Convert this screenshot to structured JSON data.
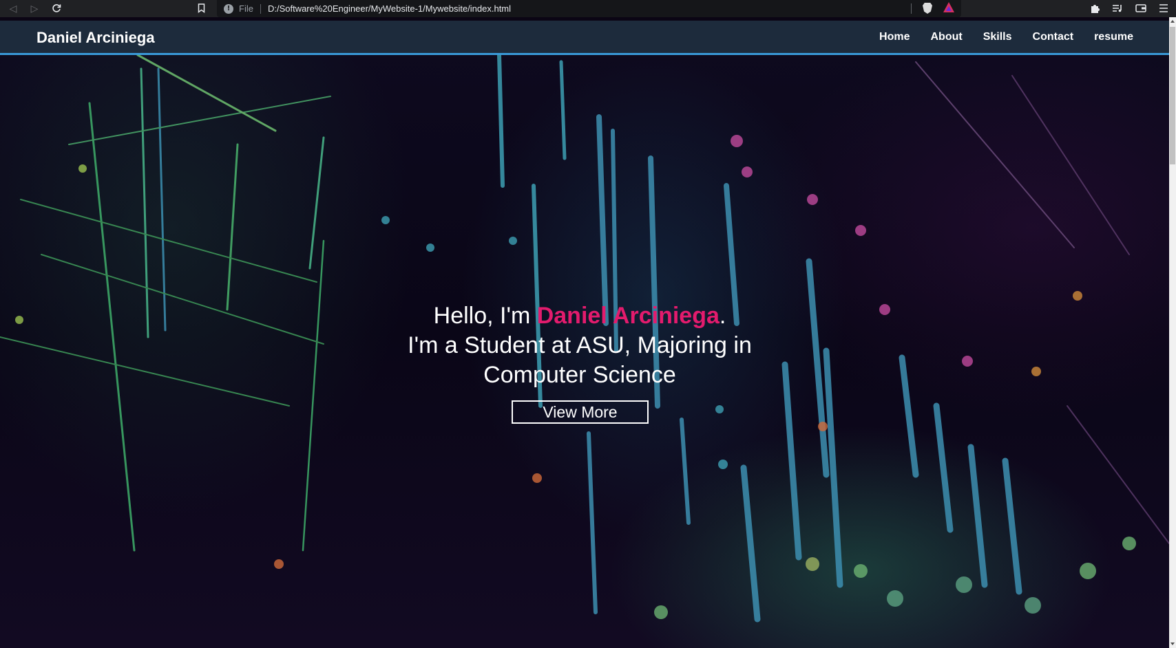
{
  "browser": {
    "scheme_label": "File",
    "url": "D:/Software%20Engineer/MyWebsite-1/Mywebsite/index.html",
    "icons": {
      "back": "back-icon",
      "forward": "forward-icon",
      "reload": "reload-icon",
      "bookmark": "bookmark-icon",
      "site_info": "info-icon",
      "brave_shields": "brave-shield-icon",
      "rewards": "brave-rewards-icon",
      "extensions": "puzzle-icon",
      "playlist": "playlist-icon",
      "wallet": "wallet-icon",
      "menu": "hamburger-menu-icon"
    }
  },
  "site": {
    "brand": "Daniel Arciniega",
    "nav": [
      "Home",
      "About",
      "Skills",
      "Contact",
      "resume"
    ],
    "hero": {
      "greeting": "Hello, I'm ",
      "name": "Daniel Arciniega",
      "period": ".",
      "line2": "I'm a Student at ASU, Majoring in",
      "line3": "Computer Science",
      "cta": "View More"
    }
  },
  "colors": {
    "nav_bg": "#1d2b3c",
    "nav_border": "#3a9ad9",
    "accent_name": "#e31b6d",
    "hero_text": "#ffffff"
  }
}
